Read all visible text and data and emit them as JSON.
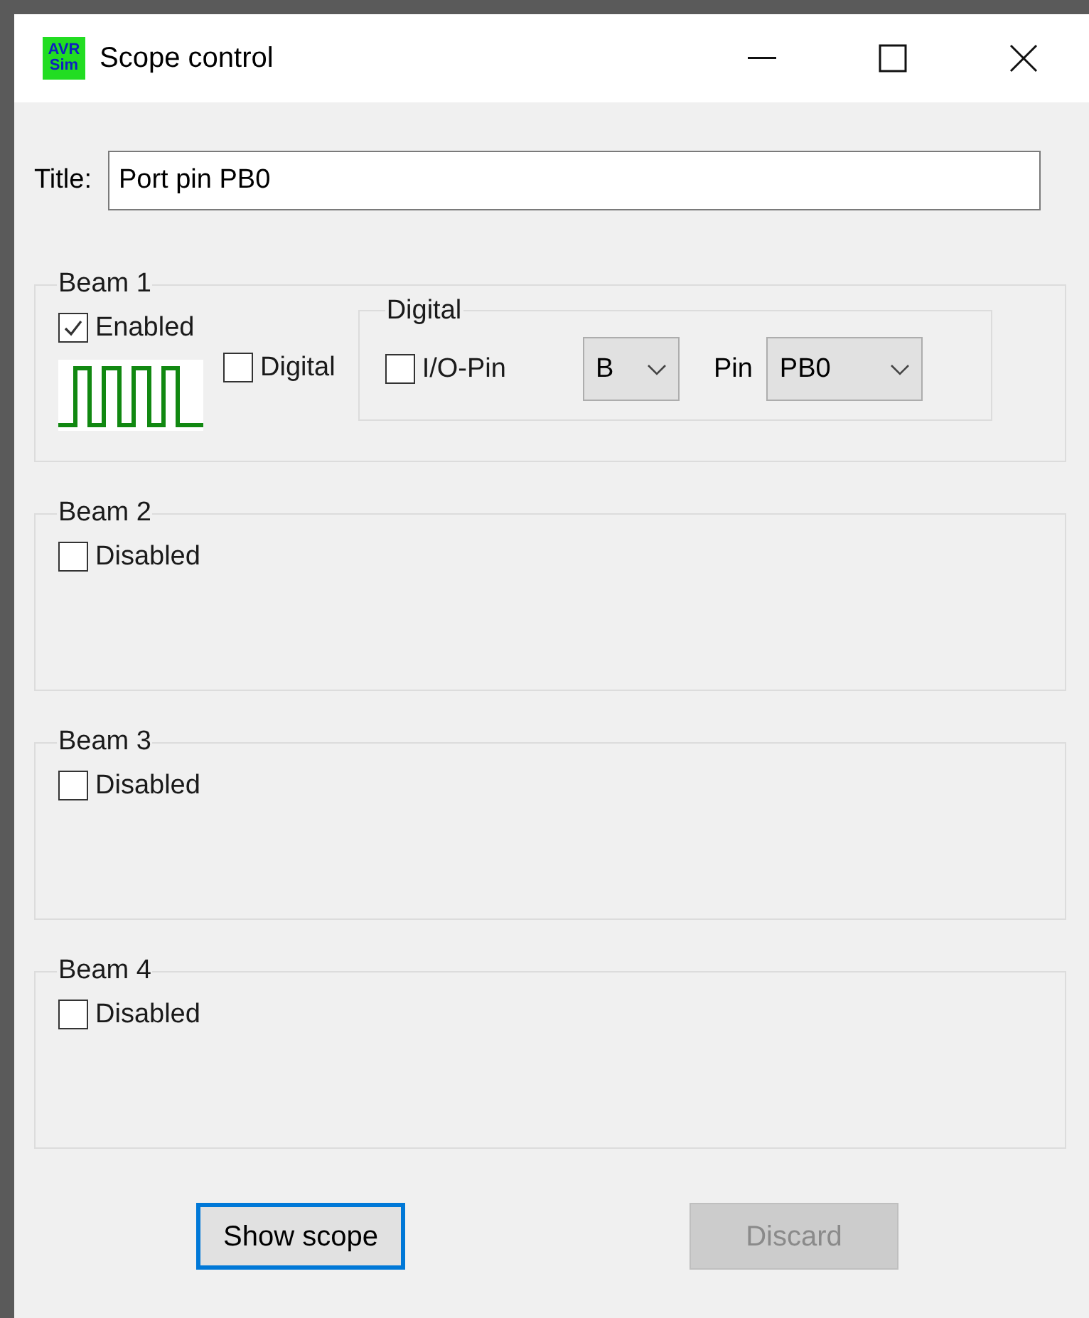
{
  "window": {
    "title": "Scope control",
    "logo_text": [
      "AVR",
      "Sim"
    ]
  },
  "title_field": {
    "label": "Title:",
    "value": "Port pin PB0"
  },
  "beams": [
    {
      "kind": "full",
      "legend": "Beam 1",
      "enabled": {
        "label": "Enabled",
        "checked": true
      },
      "digital": {
        "label": "Digital",
        "checked": false
      },
      "digital_group": {
        "legend": "Digital",
        "io_pin": {
          "label": "I/O-Pin",
          "checked": false
        },
        "port": "B",
        "pin_label": "Pin",
        "pin": "PB0"
      }
    },
    {
      "kind": "simple",
      "legend": "Beam 2",
      "enabled": {
        "label": "Disabled",
        "checked": false
      }
    },
    {
      "kind": "simple",
      "legend": "Beam 3",
      "enabled": {
        "label": "Disabled",
        "checked": false
      }
    },
    {
      "kind": "simple",
      "legend": "Beam 4",
      "enabled": {
        "label": "Disabled",
        "checked": false
      }
    }
  ],
  "buttons": [
    {
      "label": "Show scope",
      "disabled": false,
      "focused": true
    },
    {
      "label": "Discard",
      "disabled": true,
      "focused": false
    }
  ]
}
